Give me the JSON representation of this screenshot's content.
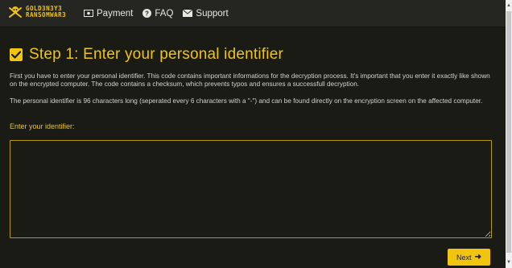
{
  "brand": {
    "logo_line1": "GOLD3N3Y3",
    "logo_line2": "RANSOMWAR3",
    "accent_color": "#f1c40f"
  },
  "nav": {
    "items": [
      {
        "label": "Payment",
        "icon": "money-icon"
      },
      {
        "label": "FAQ",
        "icon": "question-circle-icon"
      },
      {
        "label": "Support",
        "icon": "envelope-icon"
      }
    ]
  },
  "step": {
    "title": "Step 1: Enter your personal identifier",
    "icon": "check-square-icon",
    "paragraph1": "First you have to enter your personal identifier. This code contains important informations for the decryption process. It's important that you enter it exactly like shown on the encrypted computer. The code contains a checksum, which prevents typos and ensures a successfull decryption.",
    "paragraph2": "The personal identifier is 96 characters long (seperated every 6 characters with a \"-\") and can be found directly on the encryption screen on the affected computer.",
    "input_label": "Enter your identifier:",
    "identifier_value": ""
  },
  "actions": {
    "next_label": "Next"
  }
}
